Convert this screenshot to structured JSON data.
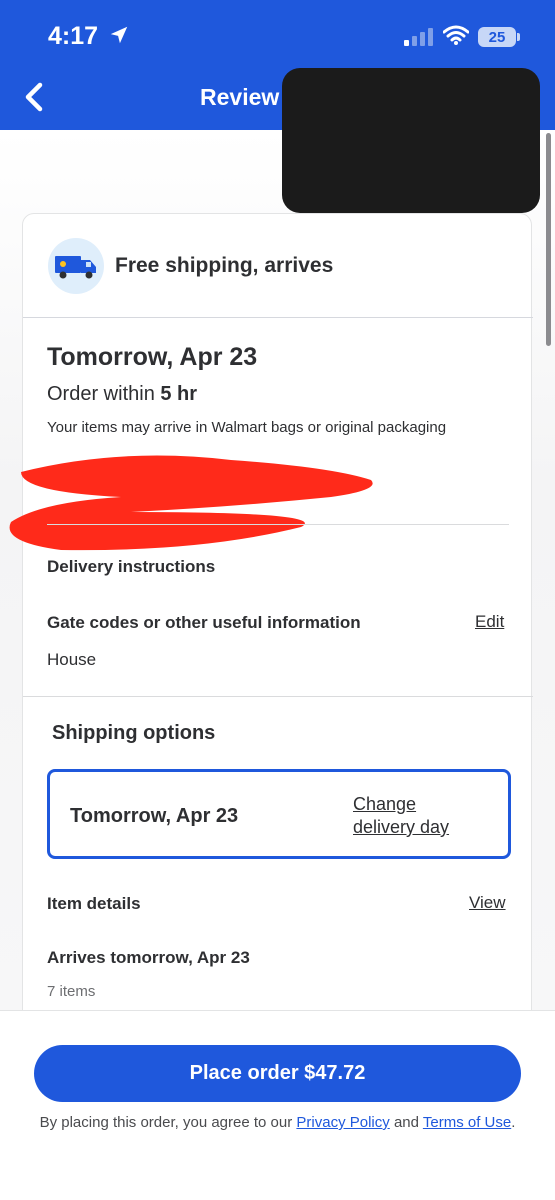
{
  "status_bar": {
    "time": "4:17",
    "battery": "25"
  },
  "header": {
    "title": "Review"
  },
  "shipping": {
    "title": "Free shipping, arrives",
    "date": "Tomorrow, Apr 23",
    "order_within_prefix": "Order within",
    "order_within_value": "5 hr",
    "bags_note": "Your items may arrive in Walmart bags or original packaging"
  },
  "delivery": {
    "instructions_label": "Delivery instructions",
    "gate_label": "Gate codes or other useful information",
    "edit_label": "Edit",
    "value": "House"
  },
  "shipping_options": {
    "title": "Shipping options",
    "selected_date": "Tomorrow, Apr 23",
    "change_label": "Change delivery day"
  },
  "items": {
    "title": "Item details",
    "view_label": "View",
    "arrives": "Arrives tomorrow, Apr 23",
    "count": "7 items"
  },
  "footer": {
    "place_order": "Place order $47.72",
    "terms_prefix": "By placing this order, you agree to our",
    "privacy": "Privacy Policy",
    "and": "and",
    "terms": "Terms of Use",
    "period": "."
  },
  "colors": {
    "brand_blue": "#1f58dc",
    "redaction_red": "#ff2a1a"
  }
}
